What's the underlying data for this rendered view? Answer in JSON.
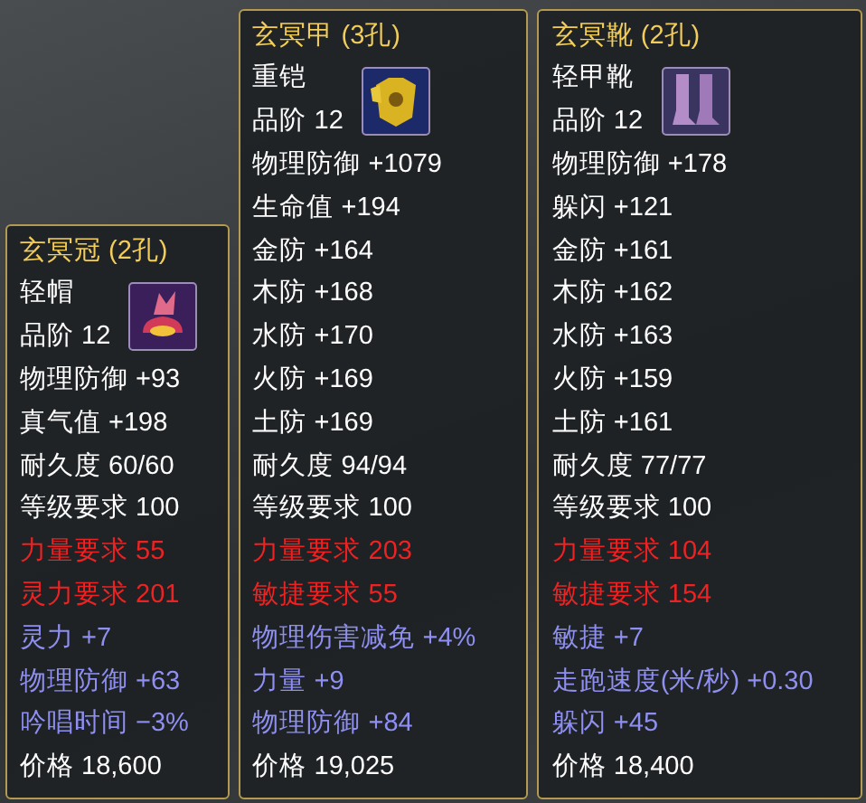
{
  "tooltips": [
    {
      "title": "玄冥冠 (2孔)",
      "icon": {
        "kind": "hat"
      },
      "head": [
        "轻帽",
        "品阶 12"
      ],
      "lines": [
        {
          "text": "物理防御 +93",
          "kind": "base"
        },
        {
          "text": "真气值 +198",
          "kind": "base"
        },
        {
          "text": "耐久度 60/60",
          "kind": "base"
        },
        {
          "text": "等级要求 100",
          "kind": "base"
        },
        {
          "text": "力量要求 55",
          "kind": "unmet"
        },
        {
          "text": "灵力要求 201",
          "kind": "unmet"
        },
        {
          "text": "灵力 +7",
          "kind": "bonus"
        },
        {
          "text": "物理防御 +63",
          "kind": "bonus"
        },
        {
          "text": "吟唱时间 −3%",
          "kind": "bonus"
        },
        {
          "text": "价格 18,600",
          "kind": "base"
        }
      ]
    },
    {
      "title": "玄冥甲 (3孔)",
      "icon": {
        "kind": "armor"
      },
      "head": [
        "重铠",
        "品阶 12"
      ],
      "lines": [
        {
          "text": "物理防御 +1079",
          "kind": "base"
        },
        {
          "text": "生命值 +194",
          "kind": "base"
        },
        {
          "text": "金防 +164",
          "kind": "base"
        },
        {
          "text": "木防 +168",
          "kind": "base"
        },
        {
          "text": "水防 +170",
          "kind": "base"
        },
        {
          "text": "火防 +169",
          "kind": "base"
        },
        {
          "text": "土防 +169",
          "kind": "base"
        },
        {
          "text": "耐久度 94/94",
          "kind": "base"
        },
        {
          "text": "等级要求 100",
          "kind": "base"
        },
        {
          "text": "力量要求 203",
          "kind": "unmet"
        },
        {
          "text": "敏捷要求 55",
          "kind": "unmet"
        },
        {
          "text": "物理伤害减免 +4%",
          "kind": "bonus"
        },
        {
          "text": "力量 +9",
          "kind": "bonus"
        },
        {
          "text": "物理防御 +84",
          "kind": "bonus"
        },
        {
          "text": "价格 19,025",
          "kind": "base"
        }
      ]
    },
    {
      "title": "玄冥靴 (2孔)",
      "icon": {
        "kind": "boots"
      },
      "head": [
        "轻甲靴",
        "品阶 12"
      ],
      "lines": [
        {
          "text": "物理防御 +178",
          "kind": "base"
        },
        {
          "text": "躲闪 +121",
          "kind": "base"
        },
        {
          "text": "金防 +161",
          "kind": "base"
        },
        {
          "text": "木防 +162",
          "kind": "base"
        },
        {
          "text": "水防 +163",
          "kind": "base"
        },
        {
          "text": "火防 +159",
          "kind": "base"
        },
        {
          "text": "土防 +161",
          "kind": "base"
        },
        {
          "text": "耐久度 77/77",
          "kind": "base"
        },
        {
          "text": "等级要求 100",
          "kind": "base"
        },
        {
          "text": "力量要求 104",
          "kind": "unmet"
        },
        {
          "text": "敏捷要求 154",
          "kind": "unmet"
        },
        {
          "text": "敏捷 +7",
          "kind": "bonus"
        },
        {
          "text": "走跑速度(米/秒) +0.30",
          "kind": "bonus"
        },
        {
          "text": "躲闪 +45",
          "kind": "bonus"
        },
        {
          "text": "价格 18,400",
          "kind": "base"
        }
      ]
    }
  ]
}
